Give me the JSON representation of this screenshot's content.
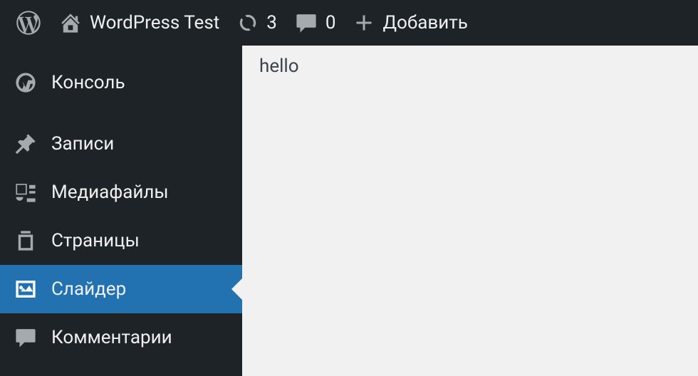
{
  "adminbar": {
    "site_name": "WordPress Test",
    "updates_count": "3",
    "comments_count": "0",
    "add_new_label": "Добавить"
  },
  "sidebar": {
    "items": [
      {
        "label": "Консоль",
        "icon": "dashboard",
        "current": false
      },
      {
        "label": "Записи",
        "icon": "pin",
        "current": false
      },
      {
        "label": "Медиафайлы",
        "icon": "media",
        "current": false
      },
      {
        "label": "Страницы",
        "icon": "pages",
        "current": false
      },
      {
        "label": "Слайдер",
        "icon": "image",
        "current": true
      },
      {
        "label": "Комментарии",
        "icon": "comment",
        "current": false
      }
    ]
  },
  "content": {
    "text": "hello"
  }
}
